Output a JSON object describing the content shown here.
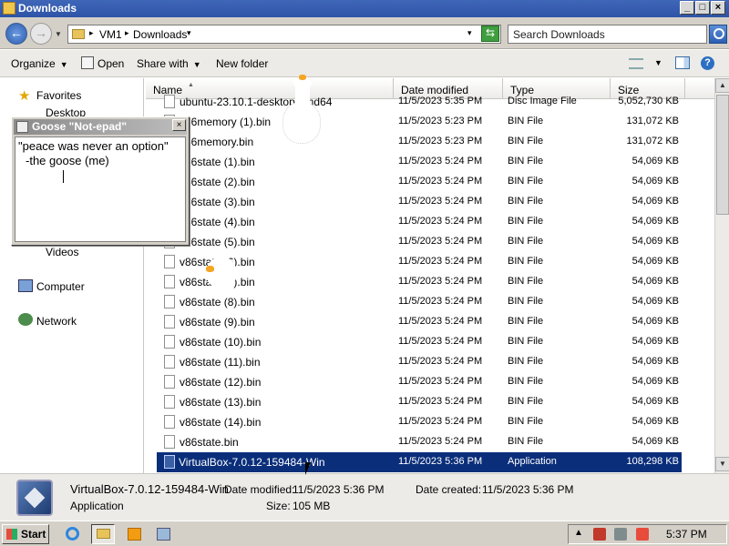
{
  "window": {
    "title": "Downloads"
  },
  "address": {
    "crumbs": [
      "VM1",
      "Downloads"
    ],
    "search_placeholder": "Search Downloads"
  },
  "toolbar": {
    "organize": "Organize",
    "open": "Open",
    "share_with": "Share with",
    "new_folder": "New folder"
  },
  "nav": {
    "favorites": "Favorites",
    "desktop": "Desktop",
    "videos": "Videos",
    "computer": "Computer",
    "network": "Network"
  },
  "columns": {
    "name": "Name",
    "date": "Date modified",
    "type": "Type",
    "size": "Size"
  },
  "files": [
    {
      "name": "ubuntu-23.10.1-desktop-amd64",
      "date": "11/5/2023 5:35 PM",
      "type": "Disc Image File",
      "size": "5,052,730 KB"
    },
    {
      "name": "v86memory (1).bin",
      "date": "11/5/2023 5:23 PM",
      "type": "BIN File",
      "size": "131,072 KB"
    },
    {
      "name": "v86memory.bin",
      "date": "11/5/2023 5:23 PM",
      "type": "BIN File",
      "size": "131,072 KB"
    },
    {
      "name": "v86state (1).bin",
      "date": "11/5/2023 5:24 PM",
      "type": "BIN File",
      "size": "54,069 KB"
    },
    {
      "name": "v86state (2).bin",
      "date": "11/5/2023 5:24 PM",
      "type": "BIN File",
      "size": "54,069 KB"
    },
    {
      "name": "v86state (3).bin",
      "date": "11/5/2023 5:24 PM",
      "type": "BIN File",
      "size": "54,069 KB"
    },
    {
      "name": "v86state (4).bin",
      "date": "11/5/2023 5:24 PM",
      "type": "BIN File",
      "size": "54,069 KB"
    },
    {
      "name": "v86state (5).bin",
      "date": "11/5/2023 5:24 PM",
      "type": "BIN File",
      "size": "54,069 KB"
    },
    {
      "name": "v86state (6).bin",
      "date": "11/5/2023 5:24 PM",
      "type": "BIN File",
      "size": "54,069 KB"
    },
    {
      "name": "v86state (7).bin",
      "date": "11/5/2023 5:24 PM",
      "type": "BIN File",
      "size": "54,069 KB"
    },
    {
      "name": "v86state (8).bin",
      "date": "11/5/2023 5:24 PM",
      "type": "BIN File",
      "size": "54,069 KB"
    },
    {
      "name": "v86state (9).bin",
      "date": "11/5/2023 5:24 PM",
      "type": "BIN File",
      "size": "54,069 KB"
    },
    {
      "name": "v86state (10).bin",
      "date": "11/5/2023 5:24 PM",
      "type": "BIN File",
      "size": "54,069 KB"
    },
    {
      "name": "v86state (11).bin",
      "date": "11/5/2023 5:24 PM",
      "type": "BIN File",
      "size": "54,069 KB"
    },
    {
      "name": "v86state (12).bin",
      "date": "11/5/2023 5:24 PM",
      "type": "BIN File",
      "size": "54,069 KB"
    },
    {
      "name": "v86state (13).bin",
      "date": "11/5/2023 5:24 PM",
      "type": "BIN File",
      "size": "54,069 KB"
    },
    {
      "name": "v86state (14).bin",
      "date": "11/5/2023 5:24 PM",
      "type": "BIN File",
      "size": "54,069 KB"
    },
    {
      "name": "v86state.bin",
      "date": "11/5/2023 5:24 PM",
      "type": "BIN File",
      "size": "54,069 KB"
    },
    {
      "name": "VirtualBox-7.0.12-159484-Win",
      "date": "11/5/2023 5:36 PM",
      "type": "Application",
      "size": "108,298 KB"
    }
  ],
  "details": {
    "name": "VirtualBox-7.0.12-159484-Win",
    "kind": "Application",
    "modified_label": "Date modified:",
    "modified": "11/5/2023 5:36 PM",
    "created_label": "Date created:",
    "created": "11/5/2023 5:36 PM",
    "size_label": "Size:",
    "size": "105 MB"
  },
  "note": {
    "title": "Goose \"Not-epad\"",
    "line1": "\"peace was never an option\"",
    "line2": "-the goose (me)"
  },
  "taskbar": {
    "start": "Start",
    "clock": "5:37 PM"
  },
  "colors": {
    "titlebar": "#2d54a6",
    "selection": "#0a2e7a",
    "beak": "#f5a623"
  }
}
